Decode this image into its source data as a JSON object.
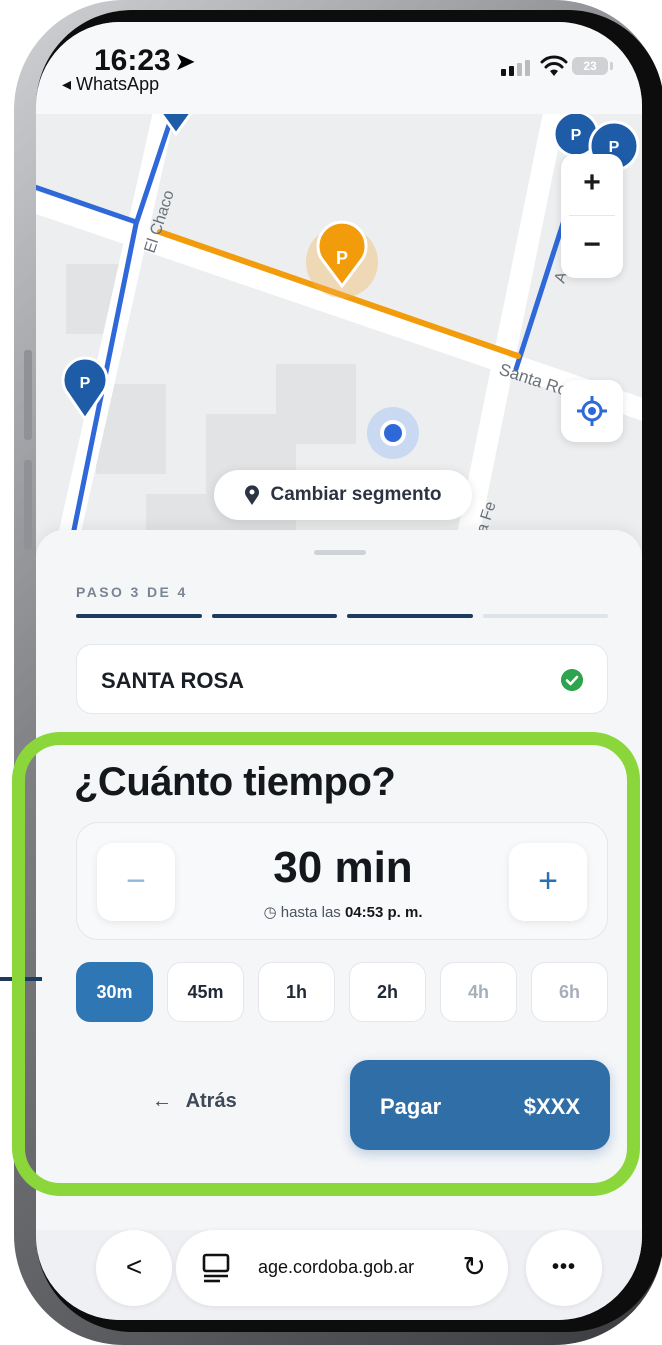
{
  "status": {
    "time": "16:23",
    "back_app": "WhatsApp",
    "battery": "23"
  },
  "map": {
    "street_labels": [
      "El Chaco",
      "Santa Rosa",
      "Fe",
      "Av"
    ],
    "zoom_in": "+",
    "zoom_out": "−",
    "change_segment": "Cambiar segmento",
    "parking_marker": "P"
  },
  "sheet": {
    "step_label": "PASO 3 DE 4",
    "progress_completed": 3,
    "progress_total": 4,
    "selected_street": "SANTA ROSA",
    "question": "¿Cuánto tiempo?",
    "duration": "30 min",
    "until_prefix": "hasta las",
    "until_time": "04:53 p. m.",
    "minus": "−",
    "plus": "+",
    "chips": [
      {
        "label": "30m",
        "state": "active"
      },
      {
        "label": "45m",
        "state": "normal"
      },
      {
        "label": "1h",
        "state": "normal"
      },
      {
        "label": "2h",
        "state": "normal"
      },
      {
        "label": "4h",
        "state": "disabled"
      },
      {
        "label": "6h",
        "state": "disabled"
      }
    ],
    "back_label": "Atrás",
    "pay_label": "Pagar",
    "pay_amount": "$XXX"
  },
  "browser": {
    "url": "age.cordoba.gob.ar",
    "back": "<",
    "more": "•••"
  },
  "colors": {
    "accent": "#2f77b4",
    "progress": "#1c3b5e",
    "highlight": "#8ad63b",
    "orange_segment": "#f29c0c",
    "blue_segment": "#2f68d8",
    "success": "#2ea44f"
  }
}
